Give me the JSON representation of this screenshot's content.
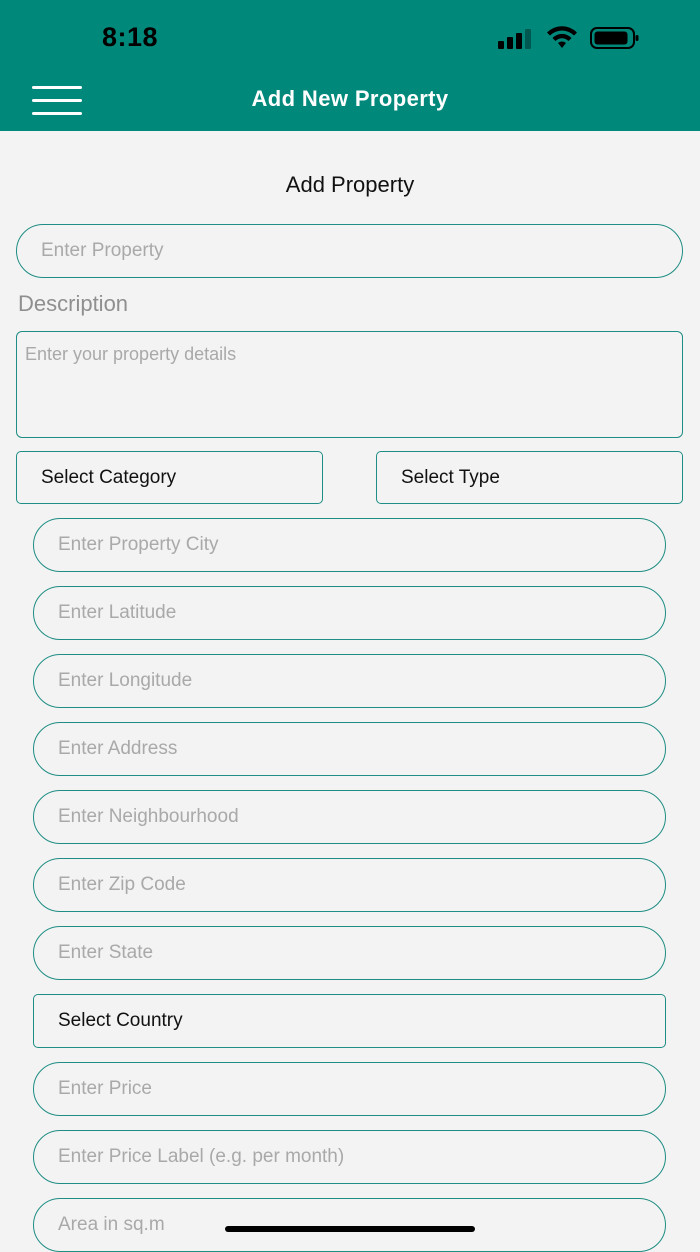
{
  "status_bar": {
    "time": "8:18",
    "icons": [
      "signal-icon",
      "wifi-icon",
      "battery-icon"
    ]
  },
  "header": {
    "title": "Add New Property",
    "menu_icon": "hamburger-menu-icon",
    "background": "#00897b"
  },
  "form": {
    "title": "Add Property",
    "property_name": {
      "placeholder": "Enter Property",
      "value": ""
    },
    "description": {
      "label": "Description",
      "placeholder": "Enter your property details",
      "value": ""
    },
    "category_select": {
      "label": "Select Category"
    },
    "type_select": {
      "label": "Select Type"
    },
    "city": {
      "placeholder": "Enter Property City"
    },
    "latitude": {
      "placeholder": "Enter Latitude"
    },
    "longitude": {
      "placeholder": "Enter Longitude"
    },
    "address": {
      "placeholder": "Enter Address"
    },
    "neighbourhood": {
      "placeholder": "Enter Neighbourhood"
    },
    "zip_code": {
      "placeholder": "Enter Zip Code"
    },
    "state": {
      "placeholder": "Enter State"
    },
    "country_select": {
      "label": "Select Country"
    },
    "price": {
      "placeholder": "Enter Price"
    },
    "price_label": {
      "placeholder": "Enter Price Label (e.g. per month)"
    },
    "area": {
      "placeholder": "Area in sq.m"
    }
  },
  "colors": {
    "accent": "#00897b",
    "border": "#1e8d83",
    "placeholder": "#a9a9a9",
    "background": "#f3f3f3"
  }
}
